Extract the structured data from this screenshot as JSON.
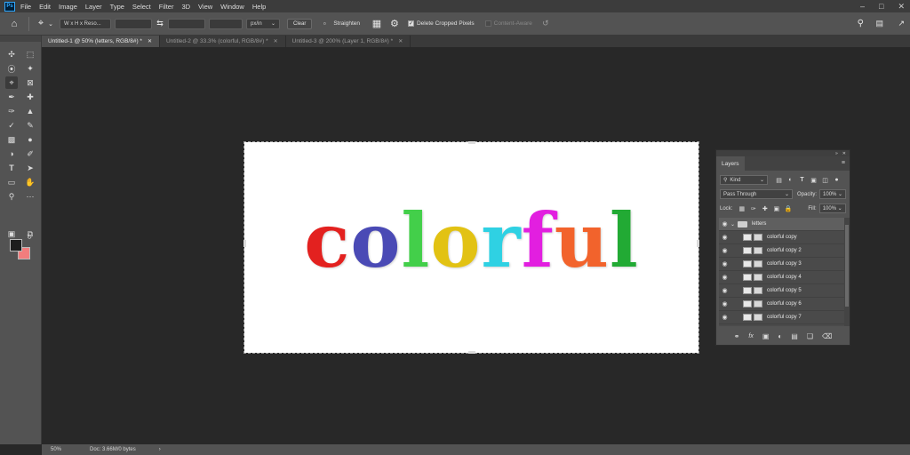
{
  "app": {
    "logo": "Ps",
    "menu": [
      "File",
      "Edit",
      "Image",
      "Layer",
      "Type",
      "Select",
      "Filter",
      "3D",
      "View",
      "Window",
      "Help"
    ],
    "window_controls": [
      "minimize-icon",
      "maximize-icon",
      "close-icon"
    ]
  },
  "options_bar": {
    "ratio_value": "W x H x Reso...",
    "units_value": "px/in",
    "clear_label": "Clear",
    "straighten_label": "Straighten",
    "delete_cropped_label": "Delete Cropped Pixels",
    "delete_cropped_checked": true,
    "content_aware_label": "Content-Aware",
    "content_aware_checked": false
  },
  "tabs": [
    {
      "label": "Untitled-1 @ 50% (letters, RGB/8#) *",
      "active": true
    },
    {
      "label": "Untitled-2 @ 33.3% (colorful, RGB/8#) *",
      "active": false
    },
    {
      "label": "Untitled-3 @ 200% (Layer 1, RGB/8#) *",
      "active": false
    }
  ],
  "canvas": {
    "letters": [
      {
        "char": "c",
        "color": "#e3211f"
      },
      {
        "char": "o",
        "color": "#4a4ab5"
      },
      {
        "char": "l",
        "color": "#43cf4a"
      },
      {
        "char": "o",
        "color": "#e2c213"
      },
      {
        "char": "r",
        "color": "#2fd1e3"
      },
      {
        "char": "f",
        "color": "#e21fe0"
      },
      {
        "char": "u",
        "color": "#f2632c"
      },
      {
        "char": "l",
        "color": "#22aa34"
      }
    ]
  },
  "colors": {
    "foreground": "#1d1d1d",
    "background": "#f27d7d"
  },
  "status_bar": {
    "zoom": "50%",
    "doc_info": "Doc: 3.66M/0 bytes"
  },
  "layers_panel": {
    "tab_label": "Layers",
    "filter_kind": "Kind",
    "blend_mode": "Pass Through",
    "opacity_label": "Opacity:",
    "opacity_value": "100%",
    "lock_label": "Lock:",
    "fill_label": "Fill:",
    "fill_value": "100%",
    "group_name": "letters",
    "layers": [
      "colorful copy",
      "colorful copy 2",
      "colorful copy 3",
      "colorful copy 4",
      "colorful copy 5",
      "colorful copy 6",
      "colorful copy 7"
    ]
  }
}
